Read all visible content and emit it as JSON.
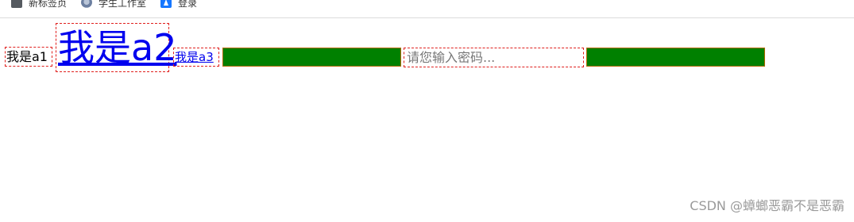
{
  "bookmarks": [
    {
      "label": "新标签页",
      "icon": "page-icon"
    },
    {
      "label": "学生工作室",
      "icon": "school-icon"
    },
    {
      "label": "登录",
      "icon": "login-icon"
    }
  ],
  "content": {
    "a1_text": "我是a1",
    "a2_text": "我是a2",
    "a3_text": "我是a3",
    "password_placeholder": "请您输入密码..."
  },
  "colors": {
    "green_box": "#008000",
    "outline": "#e0201e",
    "link": "#0000ee"
  },
  "watermark": "CSDN @蟑螂恶霸不是恶霸"
}
